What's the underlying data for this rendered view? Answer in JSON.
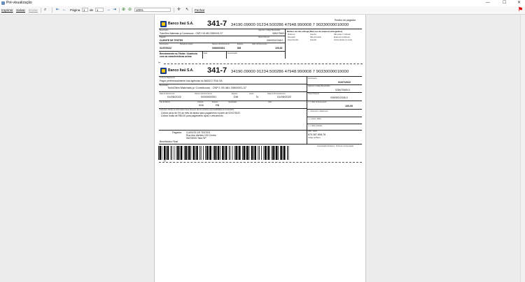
{
  "window": {
    "title": "Pré-visualização",
    "controls": [
      "—",
      "☐",
      "✕"
    ]
  },
  "toolbar": {
    "imprimir": "Imprimir",
    "salvar": "Salvar",
    "enviar": "Enviar",
    "pagina_label": "Página",
    "page_value": "1",
    "de_label": "de",
    "total_pages": "1",
    "zoom": "100%",
    "fechar": "Fechar"
  },
  "boleto": {
    "bank_name": "Banco Itaú S.A.",
    "bank_code": "341-7",
    "linha_digitavel": "34190.09000 01234.500286 47948.990008 7 90330000010000",
    "recibo_title": "Recibo do pagador",
    "lbl_beneficiario": "Beneficiário",
    "beneficiario": "TodoObra Materiais p/ Construcao - CNPJ: 05.481.339/0001-37",
    "lbl_agencia": "Agência / Código Beneficiário",
    "agencia": "0284/79469-0",
    "lbl_pagador": "Pagador",
    "pagador": "CLIENTE DE TESTES",
    "lbl_nosso_numero": "Nosso Número",
    "nosso_numero": "009/00012345-0",
    "lbl_vencimento": "Vencimento",
    "vencimento": "01/07/2022",
    "lbl_parcela": "Parcela do boleto",
    "lbl_num_doc": "Número do Documento",
    "num_doc": "0000000001",
    "lbl_especie": "Espécie",
    "especie": "DM",
    "lbl_valor_doc": "Valor do Documento",
    "valor": "100,00",
    "recebimento": "Recebimento no Titular / Ausência",
    "recebimento2": "com as características acima",
    "lbl_data": "Data",
    "lbl_autenticacao": "Autenticação",
    "motivos_title": "Motivos de não entrega (Para uso da empresa entregadora)",
    "motivos": [
      "Mudou-se",
      "Recusado",
      "Desconhecido",
      "Ausente",
      "Não procurado",
      "Falecido",
      "Não existe nº indicado",
      "Endereço insuficiente",
      "Outros (anotar no verso)"
    ],
    "lbl_local": "Local de Pagamento",
    "local": "Pagar preferencialmente nas agências do BANCO ITAU SA",
    "lbl_data_doc": "Data do Documento",
    "data_doc": "01/06/2022",
    "lbl_aceite": "Aceite",
    "aceite": "N",
    "lbl_data_proc": "Data do Processamento",
    "data_proc": "01/06/2022",
    "lbl_uso_banco": "Uso do Banco",
    "lbl_carteira": "Carteira",
    "carteira": "008",
    "lbl_especie_moeda": "Espécie",
    "especie_moeda": "R$",
    "lbl_quantidade": "Quantidade",
    "lbl_valor": "Valor",
    "lbl_instrucoes": "Instruções (Todas as informações deste bloqueto são de exclusiva responsabilidade do beneficiário)",
    "instrucao1": "Cobrar juros de 0% ao mês de atraso para pagamento a partir de 02/07/2022",
    "instrucao2": "Cobrar multa de R$0,00 para pagamento após o vencimento",
    "lbl_valor_doc_full": "( = ) Valor do Documento",
    "lbl_desconto": "( - ) Desconto / Abatimento",
    "lbl_juros": "( + ) Juros / Multa",
    "lbl_valor_cobrado": "( = ) Valor Cobrado",
    "lbl_pagador_bottom": "Pagador",
    "endereco1": "Rua dos clientes 100 Centro",
    "endereco2": "06276000 Tatui SP",
    "lbl_cpf": "CPF / CNPJ:",
    "cpf": "675.387.808-76",
    "lbl_cod_baixa": "Código da Baixa",
    "lbl_benef_final": "Beneficiário Final",
    "lbl_auth_mec": "Autenticação Mecânica - Ficha de Compensação",
    "scissors": "✂"
  }
}
